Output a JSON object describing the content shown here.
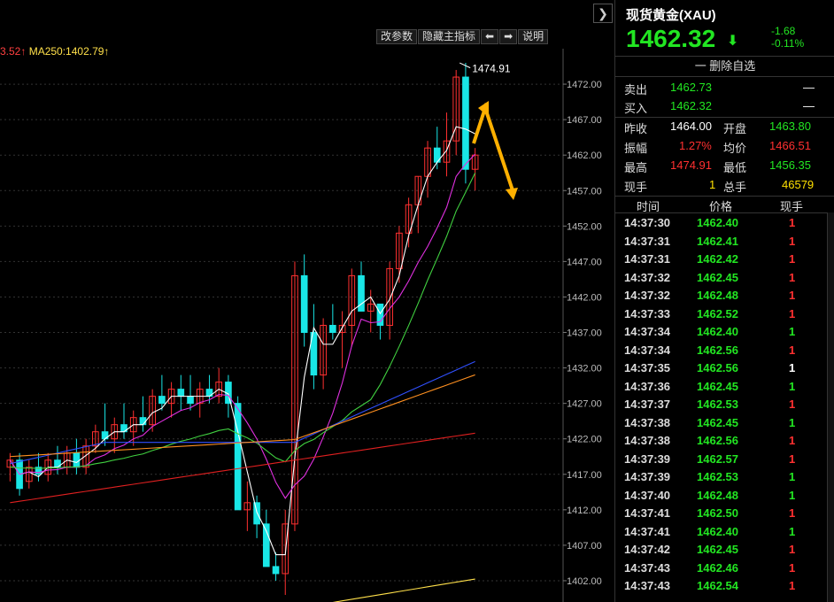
{
  "toolbar": {
    "btn_edit_params": "改参数",
    "btn_hide_indicator": "隐藏主指标",
    "btn_left": "⬅",
    "btn_right": "➡",
    "btn_help": "说明"
  },
  "ma_legend": {
    "ma_prev": "3.52↑",
    "ma250": "MA250:1402.79↑"
  },
  "collapse_label": "❯",
  "chart": {
    "high_label": "1474.91",
    "yaxis": [
      "1472.00",
      "1467.00",
      "1462.00",
      "1457.00",
      "1452.00",
      "1447.00",
      "1442.00",
      "1437.00",
      "1432.00",
      "1427.00",
      "1422.00",
      "1417.00",
      "1412.00",
      "1407.00",
      "1402.00"
    ]
  },
  "chart_data": {
    "type": "candlestick",
    "ylim": [
      1399,
      1477
    ],
    "candles": [
      [
        1418,
        1420,
        1416,
        1419
      ],
      [
        1419,
        1420,
        1414,
        1415
      ],
      [
        1416,
        1419,
        1415,
        1418
      ],
      [
        1418,
        1420,
        1416,
        1417
      ],
      [
        1417,
        1420,
        1416,
        1419
      ],
      [
        1419,
        1421,
        1417,
        1418
      ],
      [
        1418,
        1421,
        1417,
        1420
      ],
      [
        1420,
        1422,
        1417,
        1418
      ],
      [
        1418,
        1422,
        1417,
        1421
      ],
      [
        1421,
        1424,
        1420,
        1423
      ],
      [
        1423,
        1427,
        1421,
        1422
      ],
      [
        1422,
        1425,
        1420,
        1424
      ],
      [
        1424,
        1427,
        1422,
        1423
      ],
      [
        1423,
        1426,
        1421,
        1425
      ],
      [
        1425,
        1428,
        1423,
        1424
      ],
      [
        1424,
        1429,
        1423,
        1428
      ],
      [
        1428,
        1431,
        1426,
        1427
      ],
      [
        1427,
        1430,
        1425,
        1429
      ],
      [
        1429,
        1431,
        1426,
        1428
      ],
      [
        1428,
        1431,
        1426,
        1427
      ],
      [
        1427,
        1430,
        1425,
        1429
      ],
      [
        1429,
        1431,
        1427,
        1428
      ],
      [
        1428,
        1432,
        1427,
        1430
      ],
      [
        1430,
        1431,
        1425,
        1427
      ],
      [
        1427,
        1428,
        1413,
        1412
      ],
      [
        1412,
        1416,
        1409,
        1413
      ],
      [
        1413,
        1414,
        1408,
        1410
      ],
      [
        1410,
        1412,
        1404,
        1404
      ],
      [
        1404,
        1406,
        1402,
        1403
      ],
      [
        1403,
        1412,
        1400,
        1410
      ],
      [
        1410,
        1447,
        1409,
        1445
      ],
      [
        1445,
        1448,
        1435,
        1437
      ],
      [
        1437,
        1441,
        1429,
        1431
      ],
      [
        1431,
        1439,
        1429,
        1438
      ],
      [
        1438,
        1441,
        1436,
        1437
      ],
      [
        1437,
        1440,
        1432,
        1438
      ],
      [
        1438,
        1446,
        1435,
        1445
      ],
      [
        1445,
        1447,
        1440,
        1440
      ],
      [
        1440,
        1443,
        1437,
        1441
      ],
      [
        1441,
        1441,
        1436,
        1438
      ],
      [
        1438,
        1447,
        1436,
        1446
      ],
      [
        1446,
        1452,
        1444,
        1451
      ],
      [
        1451,
        1456,
        1449,
        1455
      ],
      [
        1455,
        1459,
        1451,
        1459
      ],
      [
        1459,
        1464,
        1456,
        1463
      ],
      [
        1463,
        1466,
        1460,
        1461
      ],
      [
        1461,
        1468,
        1459,
        1464
      ],
      [
        1464,
        1474,
        1462,
        1473
      ],
      [
        1473,
        1475,
        1458,
        1460
      ],
      [
        1460,
        1463,
        1457,
        1462
      ]
    ],
    "ma_lines": [
      {
        "name": "white",
        "color": "#ffffff"
      },
      {
        "name": "magenta",
        "color": "#e030e0"
      },
      {
        "name": "green",
        "color": "#40d040"
      },
      {
        "name": "blue",
        "color": "#3050ff"
      },
      {
        "name": "orange",
        "color": "#ff9020"
      },
      {
        "name": "red",
        "color": "#e02020"
      },
      {
        "name": "MA250",
        "color": "#ffe04a"
      }
    ]
  },
  "panel": {
    "title": "现货黄金(XAU)",
    "price": "1462.32",
    "change": "-1.68",
    "change_pct": "-0.11%",
    "del_label": "一 删除自选",
    "sell_label": "卖出",
    "sell_price": "1462.73",
    "sell_vol": "—",
    "buy_label": "买入",
    "buy_price": "1462.32",
    "buy_vol": "—",
    "prev_close_label": "昨收",
    "prev_close": "1464.00",
    "open_label": "开盘",
    "open": "1463.80",
    "amp_label": "振幅",
    "amp": "1.27%",
    "avg_label": "均价",
    "avg": "1466.51",
    "high_label": "最高",
    "high": "1474.91",
    "low_label": "最低",
    "low": "1456.35",
    "curhand_label": "现手",
    "curhand": "1",
    "total_label": "总手",
    "total": "46579"
  },
  "ticks_header": {
    "time": "时间",
    "price": "价格",
    "vol": "现手"
  },
  "ticks": [
    {
      "time": "14:37:30",
      "price": "1462.40",
      "vol": "1",
      "vc": "red"
    },
    {
      "time": "14:37:31",
      "price": "1462.41",
      "vol": "1",
      "vc": "red"
    },
    {
      "time": "14:37:31",
      "price": "1462.42",
      "vol": "1",
      "vc": "red"
    },
    {
      "time": "14:37:32",
      "price": "1462.45",
      "vol": "1",
      "vc": "red"
    },
    {
      "time": "14:37:32",
      "price": "1462.48",
      "vol": "1",
      "vc": "red"
    },
    {
      "time": "14:37:33",
      "price": "1462.52",
      "vol": "1",
      "vc": "red"
    },
    {
      "time": "14:37:34",
      "price": "1462.40",
      "vol": "1",
      "vc": "green"
    },
    {
      "time": "14:37:34",
      "price": "1462.56",
      "vol": "1",
      "vc": "red"
    },
    {
      "time": "14:37:35",
      "price": "1462.56",
      "vol": "1",
      "vc": "white"
    },
    {
      "time": "14:37:36",
      "price": "1462.45",
      "vol": "1",
      "vc": "green"
    },
    {
      "time": "14:37:37",
      "price": "1462.53",
      "vol": "1",
      "vc": "red"
    },
    {
      "time": "14:37:38",
      "price": "1462.45",
      "vol": "1",
      "vc": "green"
    },
    {
      "time": "14:37:38",
      "price": "1462.56",
      "vol": "1",
      "vc": "red"
    },
    {
      "time": "14:37:39",
      "price": "1462.57",
      "vol": "1",
      "vc": "red"
    },
    {
      "time": "14:37:39",
      "price": "1462.53",
      "vol": "1",
      "vc": "green"
    },
    {
      "time": "14:37:40",
      "price": "1462.48",
      "vol": "1",
      "vc": "green"
    },
    {
      "time": "14:37:41",
      "price": "1462.50",
      "vol": "1",
      "vc": "red"
    },
    {
      "time": "14:37:41",
      "price": "1462.40",
      "vol": "1",
      "vc": "green"
    },
    {
      "time": "14:37:42",
      "price": "1462.45",
      "vol": "1",
      "vc": "red"
    },
    {
      "time": "14:37:43",
      "price": "1462.46",
      "vol": "1",
      "vc": "red"
    },
    {
      "time": "14:37:43",
      "price": "1462.54",
      "vol": "1",
      "vc": "red"
    }
  ],
  "colors": {
    "up": "#ff3030",
    "down": "#19e6e6",
    "accent": "#ffb000"
  }
}
